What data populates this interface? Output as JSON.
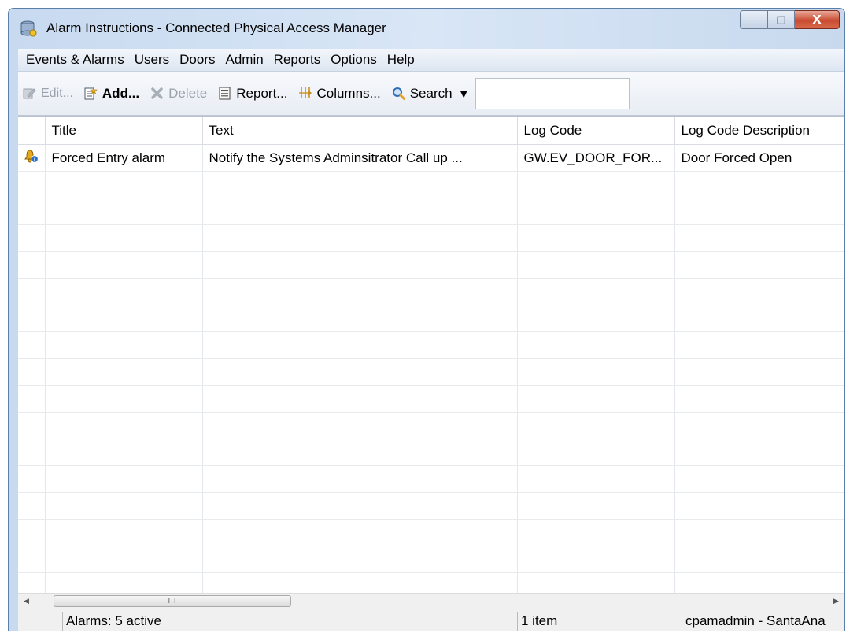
{
  "window": {
    "title": "Alarm Instructions - Connected Physical Access Manager",
    "minimize_glyph": "—",
    "maximize_glyph": "□",
    "close_glyph": "X"
  },
  "menu": {
    "items": [
      {
        "label": "Events & Alarms"
      },
      {
        "label": "Users"
      },
      {
        "label": "Doors"
      },
      {
        "label": "Admin"
      },
      {
        "label": "Reports"
      },
      {
        "label": "Options"
      },
      {
        "label": "Help"
      }
    ]
  },
  "toolbar": {
    "edit_label": "Edit...",
    "add_label": "Add...",
    "delete_label": "Delete",
    "report_label": "Report...",
    "columns_label": "Columns...",
    "search_label": "Search",
    "search_value": ""
  },
  "table": {
    "columns": [
      "",
      "Title",
      "Text",
      "Log Code",
      "Log Code Description"
    ],
    "rows": [
      {
        "icon": "alarm-info-icon",
        "title": "Forced Entry alarm",
        "text": "Notify the Systems Adminsitrator  Call up ...",
        "log_code": "GW.EV_DOOR_FOR...",
        "log_code_description": "Door Forced Open"
      }
    ],
    "empty_row_count": 17
  },
  "scrollbar": {
    "thumb_grip": "III",
    "left_arrow": "◀",
    "right_arrow": "▶"
  },
  "status": {
    "alarms": "Alarms: 5 active",
    "items": "1 item",
    "user": "cpamadmin - SantaAna"
  },
  "colors": {
    "window_frame": "#c8daf0",
    "close_button": "#c94b31",
    "alarm_icon": "#e0a800"
  }
}
